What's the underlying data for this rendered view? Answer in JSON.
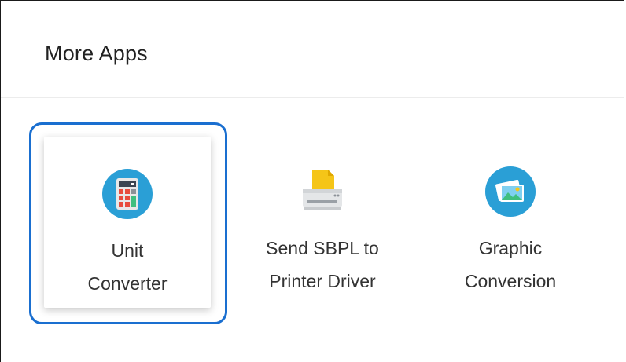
{
  "header": {
    "title": "More Apps"
  },
  "apps": [
    {
      "line1": "Unit",
      "line2": "Converter",
      "icon": "calculator-icon",
      "selected": true
    },
    {
      "line1": "Send SBPL to",
      "line2": "Printer Driver",
      "icon": "printer-icon",
      "selected": false
    },
    {
      "line1": "Graphic",
      "line2": "Conversion",
      "icon": "image-icon",
      "selected": false
    }
  ],
  "colors": {
    "selection_border": "#1a6fd0",
    "icon_circle_blue": "#2a9fd6",
    "printer_yellow": "#f5c518"
  }
}
